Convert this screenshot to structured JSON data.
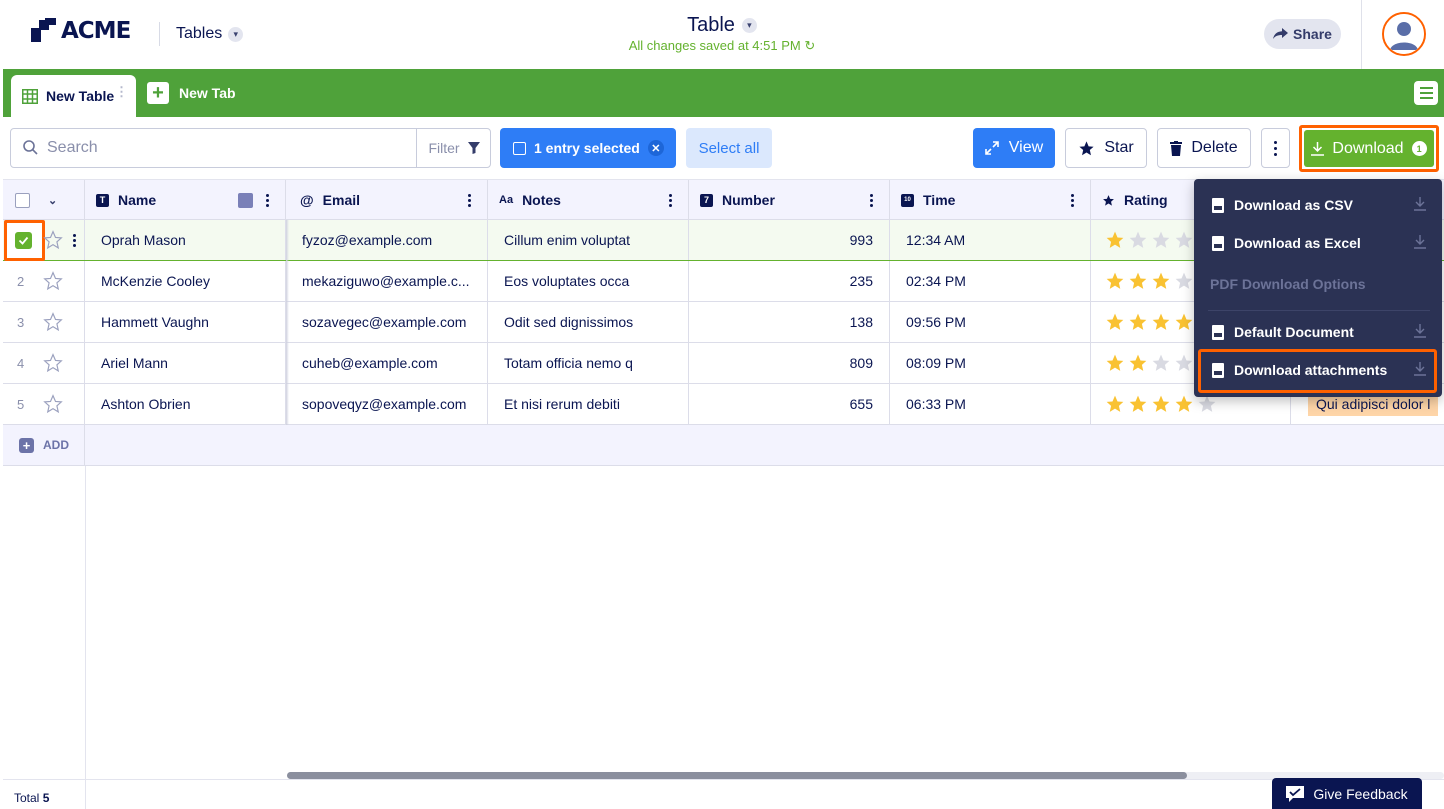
{
  "header": {
    "logo_text": "ACME",
    "tables_label": "Tables",
    "doc_title": "Table",
    "saved_status": "All changes saved at 4:51 PM",
    "share_label": "Share"
  },
  "tabs": {
    "active_label": "New Table",
    "new_tab_label": "New Tab"
  },
  "toolbar": {
    "search_placeholder": "Search",
    "filter_label": "Filter",
    "selection_label": "1 entry selected",
    "select_all_label": "Select all",
    "view_label": "View",
    "star_label": "Star",
    "delete_label": "Delete",
    "download_label": "Download",
    "download_badge": "1"
  },
  "columns": [
    {
      "label": "Name",
      "icon": "T"
    },
    {
      "label": "Email",
      "icon": "@"
    },
    {
      "label": "Notes",
      "icon": "Aa"
    },
    {
      "label": "Number",
      "icon": "7"
    },
    {
      "label": "Time",
      "icon": "calendar"
    },
    {
      "label": "Rating",
      "icon": "star"
    }
  ],
  "rows": [
    {
      "index": "1",
      "name": "Oprah Mason",
      "email": "fyzoz@example.com",
      "notes": "Cillum enim voluptat",
      "number": "993",
      "time": "12:34 AM",
      "rating": 1,
      "selected": true
    },
    {
      "index": "2",
      "name": "McKenzie Cooley",
      "email": "mekaziguwo@example.c...",
      "notes": "Eos voluptates occa",
      "number": "235",
      "time": "02:34 PM",
      "rating": 3,
      "selected": false
    },
    {
      "index": "3",
      "name": "Hammett Vaughn",
      "email": "sozavegec@example.com",
      "notes": "Odit sed dignissimos",
      "number": "138",
      "time": "09:56 PM",
      "rating": 4,
      "selected": false
    },
    {
      "index": "4",
      "name": "Ariel Mann",
      "email": "cuheb@example.com",
      "notes": "Totam officia nemo q",
      "number": "809",
      "time": "08:09 PM",
      "rating": 2,
      "selected": false
    },
    {
      "index": "5",
      "name": "Ashton Obrien",
      "email": "sopoveqyz@example.com",
      "notes": "Et nisi rerum debiti",
      "number": "655",
      "time": "06:33 PM",
      "rating": 4,
      "selected": false
    }
  ],
  "row5_extra_tag": "Qui adipisci dolor l",
  "add_label": "ADD",
  "footer": {
    "total_label": "Total",
    "total_count": "5",
    "feedback_label": "Give Feedback"
  },
  "download_menu": {
    "csv": "Download as CSV",
    "excel": "Download as Excel",
    "pdf_section": "PDF Download Options",
    "default_doc": "Default Document",
    "attachments": "Download attachments"
  },
  "colors": {
    "brand_green": "#4fa23a",
    "accent_blue": "#2e7df6",
    "highlight_orange": "#ff6100",
    "navy": "#0a1551",
    "star_gold": "#f9c232"
  }
}
